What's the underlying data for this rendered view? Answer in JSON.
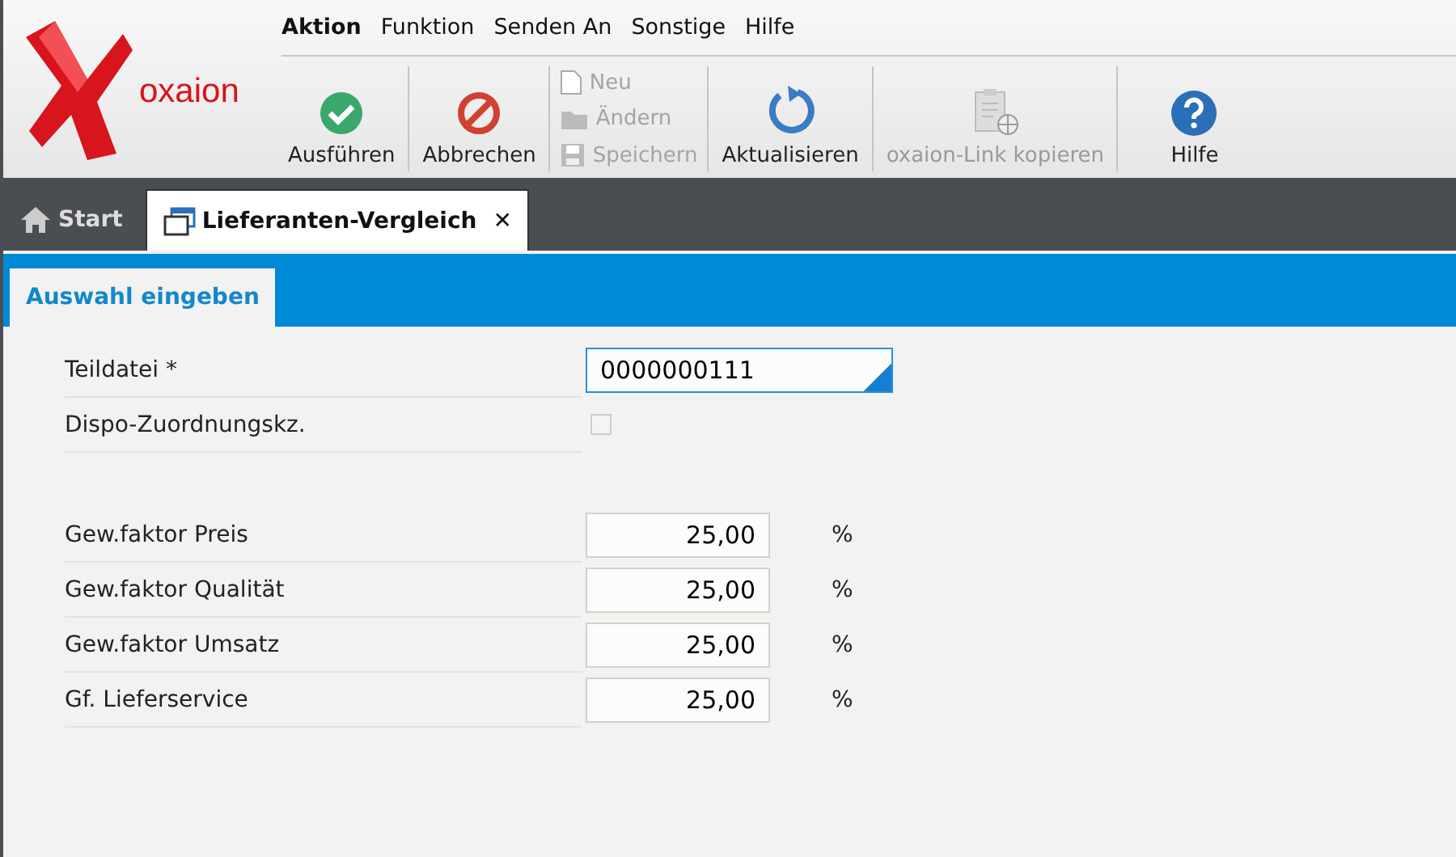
{
  "app": {
    "logo": "oxaion"
  },
  "menu": [
    {
      "label": "Aktion",
      "selected": true
    },
    {
      "label": "Funktion",
      "selected": false
    },
    {
      "label": "Senden An",
      "selected": false
    },
    {
      "label": "Sonstige",
      "selected": false
    },
    {
      "label": "Hilfe",
      "selected": false
    }
  ],
  "toolbar": [
    {
      "kind": "big",
      "label": "Ausführen",
      "disabled": false
    },
    {
      "kind": "big",
      "label": "Abbrechen",
      "disabled": false
    },
    {
      "kind": "stack",
      "items": [
        {
          "label": "Neu",
          "disabled": true
        },
        {
          "label": "Ändern",
          "disabled": true
        },
        {
          "label": "Speichern",
          "disabled": true
        }
      ]
    },
    {
      "kind": "big",
      "label": "Aktualisieren",
      "disabled": false
    },
    {
      "kind": "big",
      "label": "oxaion-Link kopieren",
      "disabled": true
    },
    {
      "kind": "big",
      "label": "Hilfe",
      "disabled": false
    }
  ],
  "tabs": [
    {
      "kind": "home",
      "label": "Start",
      "selected": false
    },
    {
      "kind": "window",
      "label": "Lieferanten-Vergleich",
      "selected": true,
      "close": "✕"
    }
  ],
  "subtabs": [
    {
      "label": "Auswahl eingeben",
      "selected": true
    }
  ],
  "fields": [
    {
      "kind": "text",
      "label": "Teildatei *",
      "value": "0000000111",
      "focused": true
    },
    {
      "kind": "checkbox",
      "label": "Dispo-Zuordnungskz.",
      "checked": false
    },
    {
      "kind": "gap"
    },
    {
      "kind": "number",
      "label": "Gew.faktor Preis",
      "value": "25,00",
      "unit": "%"
    },
    {
      "kind": "number",
      "label": "Gew.faktor Qualität",
      "value": "25,00",
      "unit": "%"
    },
    {
      "kind": "number",
      "label": "Gew.faktor Umsatz",
      "value": "25,00",
      "unit": "%"
    },
    {
      "kind": "number",
      "label": "Gf. Lieferservice",
      "value": "25,00",
      "unit": "%"
    }
  ]
}
